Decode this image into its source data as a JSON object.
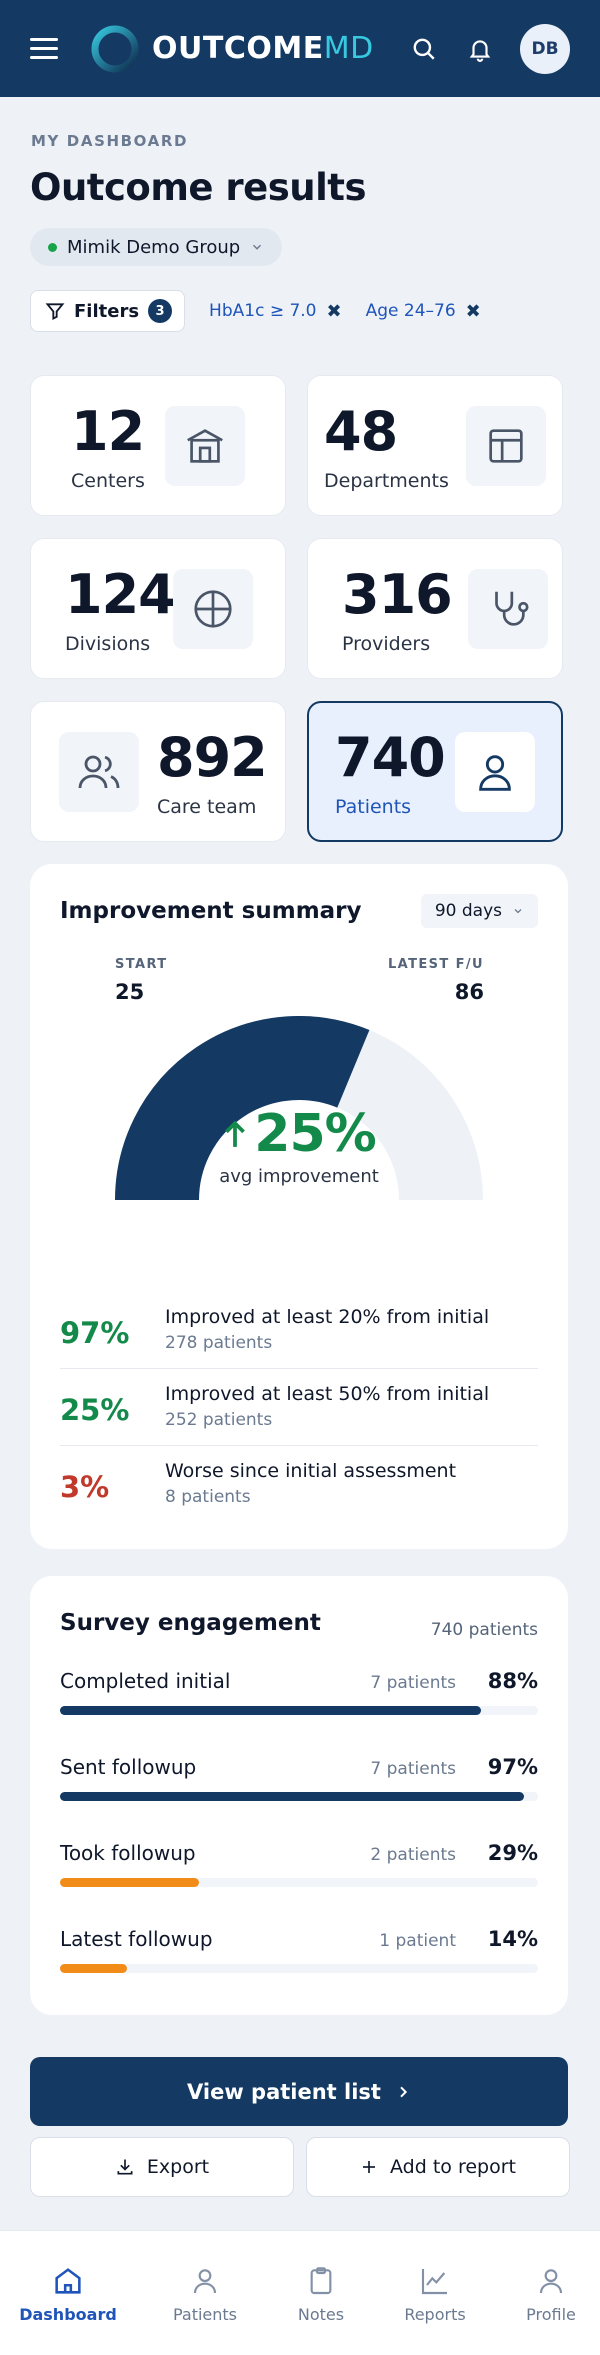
{
  "header": {
    "logo_primary": "OUTCOME",
    "logo_accent": "MD",
    "avatar_initials": "DB"
  },
  "page": {
    "eyebrow": "MY DASHBOARD",
    "title": "Outcome results",
    "group": "Mimik Demo Group"
  },
  "filters": {
    "label": "Filters",
    "count": "3",
    "chips": [
      "HbA1c ≥ 7.0",
      "Age 24–76"
    ]
  },
  "stats": [
    {
      "value": "12",
      "label": "Centers",
      "icon": "building-icon"
    },
    {
      "value": "48",
      "label": "Departments",
      "icon": "layout-icon"
    },
    {
      "value": "124",
      "label": "Divisions",
      "icon": "crosshair-icon"
    },
    {
      "value": "316",
      "label": "Providers",
      "icon": "stethoscope-icon"
    },
    {
      "value": "892",
      "label": "Care team",
      "icon": "users-icon"
    },
    {
      "value": "740",
      "label": "Patients",
      "icon": "user-icon",
      "selected": true
    }
  ],
  "improvement": {
    "title": "Improvement summary",
    "period": "90 days",
    "start_label": "START",
    "start_value": "25",
    "latest_label": "LATEST F/U",
    "latest_value": "86",
    "avg_pct": "25%",
    "avg_label": "avg improvement",
    "gauge_fraction": 0.625,
    "rows": [
      {
        "pct": "97%",
        "text": "Improved at least 20% from initial",
        "sub": "278 patients",
        "color": "#138a4a"
      },
      {
        "pct": "25%",
        "text": "Improved at least 50% from initial",
        "sub": "252 patients",
        "color": "#138a4a"
      },
      {
        "pct": "3%",
        "text": "Worse since initial assessment",
        "sub": "8 patients",
        "color": "#c0392b"
      }
    ]
  },
  "survey": {
    "title": "Survey engagement",
    "total": "740 patients",
    "rows": [
      {
        "label": "Completed initial",
        "count": "7 patients",
        "pct": "88%",
        "fraction": 0.88,
        "color": "#143a64"
      },
      {
        "label": "Sent followup",
        "count": "7 patients",
        "pct": "97%",
        "fraction": 0.97,
        "color": "#143a64"
      },
      {
        "label": "Took followup",
        "count": "2 patients",
        "pct": "29%",
        "fraction": 0.29,
        "color": "#f28c18"
      },
      {
        "label": "Latest followup",
        "count": "1 patient",
        "pct": "14%",
        "fraction": 0.14,
        "color": "#f28c18"
      }
    ]
  },
  "actions": {
    "primary": "View patient list",
    "export": "Export",
    "add_report": "Add to report"
  },
  "nav": [
    {
      "label": "Dashboard",
      "active": true
    },
    {
      "label": "Patients"
    },
    {
      "label": "Notes"
    },
    {
      "label": "Reports"
    },
    {
      "label": "Profile"
    }
  ]
}
